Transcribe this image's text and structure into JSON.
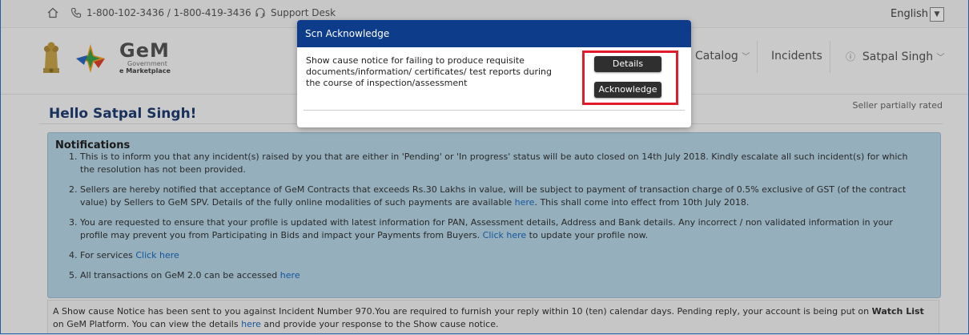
{
  "topbar": {
    "phone": "1-800-102-3436 / 1-800-419-3436",
    "support": "Support Desk",
    "language": "English"
  },
  "header": {
    "logo_big": "GeM",
    "logo_sub1": "Government",
    "logo_sub2": "e Marketplace",
    "nav": {
      "catalog": "Catalog",
      "incidents": "Incidents",
      "user": "Satpal Singh"
    }
  },
  "main": {
    "greeting": "Hello Satpal Singh!",
    "rating": "Seller partially rated",
    "notifications_title": "Notifications",
    "notifications": [
      {
        "text": "This is to inform you that any incident(s) raised by you that are either in 'Pending' or 'In progress' status will be auto closed on 14th July 2018. Kindly escalate all such incident(s) for which the resolution has not been provided."
      },
      {
        "pre": "Sellers are hereby notified that acceptance of GeM Contracts that exceeds Rs.30 Lakhs in value, will be subject to payment of transaction charge of 0.5% exclusive of GST (of the contract value) by Sellers to GeM SPV. Details of the fully online modalities of such payments are available ",
        "link": "here",
        "post": ". This shall come into effect from 10th July 2018."
      },
      {
        "pre": "You are requested to ensure that your profile is updated with latest information for PAN, Assessment details, Address and Bank details. Any incorrect / non validated information in your profile may prevent you from Participating in Bids and impact your Payments from Buyers. ",
        "link": "Click here",
        "post": " to update your profile now."
      },
      {
        "pre": "For services ",
        "link": "Click here",
        "post": ""
      },
      {
        "pre": "All transactions on GeM 2.0 can be accessed ",
        "link": "here",
        "post": ""
      }
    ],
    "scn_notice": {
      "pre": "A Show cause Notice has been sent to you against Incident Number 970.You are required to furnish your reply within 10 (ten) calendar days. Pending reply, your account is being put on ",
      "bold": "Watch List",
      "mid": " on GeM Platform. You can view the details ",
      "link": "here",
      "post": " and provide your response to the Show cause notice."
    }
  },
  "modal": {
    "title": "Scn Acknowledge",
    "message": "Show cause notice for failing to produce requisite documents/information/ certificates/ test reports during the course of inspection/assessment",
    "details_label": "Details",
    "acknowledge_label": "Acknowledge",
    "highlight_color": "#e21b2b",
    "header_color": "#0d3d8a"
  }
}
